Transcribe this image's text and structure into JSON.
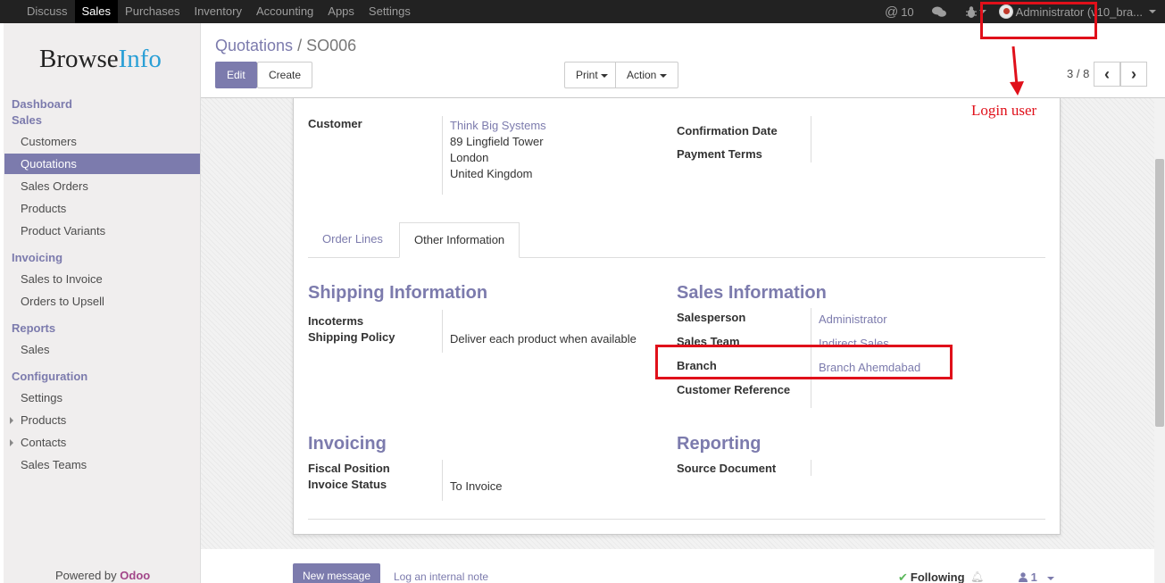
{
  "topbar": {
    "menu": [
      "Discuss",
      "Sales",
      "Purchases",
      "Inventory",
      "Accounting",
      "Apps",
      "Settings"
    ],
    "active_menu": "Sales",
    "mentions_count": "10",
    "user_label": "Administrator (v10_bra..."
  },
  "sidebar": {
    "brand_a": "Browse",
    "brand_b": "Info",
    "sections": {
      "dashboard": "Dashboard",
      "sales": "Sales",
      "invoicing": "Invoicing",
      "reports": "Reports",
      "configuration": "Configuration"
    },
    "items": {
      "customers": "Customers",
      "quotations": "Quotations",
      "sales_orders": "Sales Orders",
      "products": "Products",
      "product_variants": "Product Variants",
      "sales_to_invoice": "Sales to Invoice",
      "orders_to_upsell": "Orders to Upsell",
      "reports_sales": "Sales",
      "settings": "Settings",
      "config_products": "Products",
      "contacts": "Contacts",
      "sales_teams": "Sales Teams"
    },
    "powered_by": "Powered by ",
    "powered_brand": "Odoo"
  },
  "control": {
    "breadcrumb_link": "Quotations",
    "breadcrumb_sep": " / ",
    "breadcrumb_current": "SO006",
    "edit": "Edit",
    "create": "Create",
    "print": "Print",
    "action": "Action",
    "pager": "3 / 8",
    "prev": "‹",
    "next": "›"
  },
  "form": {
    "customer_label": "Customer",
    "customer_name": "Think Big Systems",
    "customer_addr1": "89 Lingfield Tower",
    "customer_addr2": "London",
    "customer_addr3": "United Kingdom",
    "confirmation_date_label": "Confirmation Date",
    "payment_terms_label": "Payment Terms",
    "tab_order_lines": "Order Lines",
    "tab_other_info": "Other Information",
    "shipping_title": "Shipping Information",
    "incoterms_label": "Incoterms",
    "shipping_policy_label": "Shipping Policy",
    "shipping_policy_value": "Deliver each product when available",
    "sales_info_title": "Sales Information",
    "salesperson_label": "Salesperson",
    "salesperson_value": "Administrator",
    "sales_team_label": "Sales Team",
    "sales_team_value": "Indirect Sales",
    "branch_label": "Branch",
    "branch_value": "Branch Ahemdabad",
    "customer_ref_label": "Customer Reference",
    "invoicing_title": "Invoicing",
    "fiscal_position_label": "Fiscal Position",
    "invoice_status_label": "Invoice Status",
    "invoice_status_value": "To Invoice",
    "reporting_title": "Reporting",
    "source_document_label": "Source Document"
  },
  "annotation": {
    "login_note": "Login user",
    "color": "#e0101a"
  },
  "chatter": {
    "new_message": "New message",
    "log_note": "Log an internal note",
    "following": "Following",
    "followers_count": "1"
  },
  "colors": {
    "accent": "#7c7bad",
    "topbar": "#222222"
  }
}
